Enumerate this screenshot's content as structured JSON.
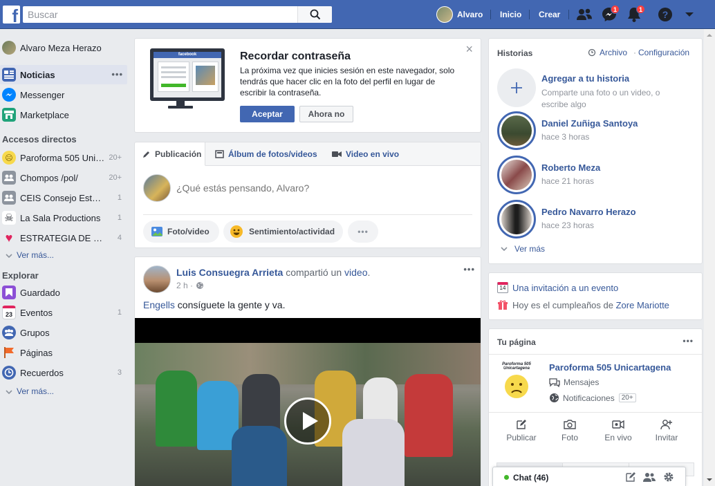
{
  "topbar": {
    "logo": "f",
    "search_placeholder": "Buscar",
    "user": "Alvaro",
    "home": "Inicio",
    "create": "Crear",
    "messenger_badge": "1",
    "notif_badge": "1"
  },
  "left": {
    "profile": "Alvaro Meza Herazo",
    "main": [
      {
        "label": "Noticias"
      },
      {
        "label": "Messenger"
      },
      {
        "label": "Marketplace"
      }
    ],
    "shortcuts_title": "Accesos directos",
    "shortcuts": [
      {
        "label": "Paroforma 505 Unicartagena",
        "count": "20+"
      },
      {
        "label": "Chompos /pol/",
        "count": "20+"
      },
      {
        "label": "CEIS Consejo Estudiantil",
        "count": "1"
      },
      {
        "label": "La Sala Productions",
        "count": "1"
      },
      {
        "label": "ESTRATEGIA DE MERCADEO",
        "count": "4"
      }
    ],
    "see_more": "Ver más...",
    "explore_title": "Explorar",
    "explore": [
      {
        "label": "Guardado",
        "count": ""
      },
      {
        "label": "Eventos",
        "count": "1"
      },
      {
        "label": "Grupos",
        "count": ""
      },
      {
        "label": "Páginas",
        "count": ""
      },
      {
        "label": "Recuerdos",
        "count": "3"
      }
    ],
    "see_more2": "Ver más..."
  },
  "remember": {
    "title": "Recordar contraseña",
    "body": "La próxima vez que inicies sesión en este navegador, solo tendrás que hacer clic en la foto del perfil en lugar de escribir la contraseña.",
    "accept": "Aceptar",
    "decline": "Ahora no",
    "close": "×",
    "mock_brand": "facebook"
  },
  "composer": {
    "tabs": [
      "Publicación",
      "Álbum de fotos/videos",
      "Video en vivo"
    ],
    "placeholder": "¿Qué estás pensando, Alvaro?",
    "actions": [
      "Foto/video",
      "Sentimiento/actividad"
    ],
    "more": "•••"
  },
  "post": {
    "author": "Luis Consuegra Arrieta",
    "shared": "compartió un",
    "video_word": "video",
    "time": "2 h ·",
    "mention": "Engells",
    "text": " consíguete la gente y va.",
    "menu": "•••"
  },
  "stories": {
    "title": "Historias",
    "archive": "Archivo",
    "config": "Configuración",
    "add_title": "Agregar a tu historia",
    "add_sub": "Comparte una foto o un video, o escribe algo",
    "items": [
      {
        "name": "Daniel Zuñiga Santoya",
        "time": "hace 3 horas"
      },
      {
        "name": "Roberto Meza",
        "time": "hace 21 horas"
      },
      {
        "name": "Pedro Navarro Herazo",
        "time": "hace 23 horas"
      }
    ],
    "see_more": "Ver más"
  },
  "events": {
    "invite": "Una invitación a un evento",
    "birthday_prefix": "Hoy es el cumpleaños de ",
    "birthday_name": "Zore Mariotte",
    "calendar_day": "14"
  },
  "page": {
    "title": "Tu página",
    "name": "Paroforma 505 Unicartagena",
    "messages": "Mensajes",
    "notifications": "Notificaciones",
    "notif_count": "20+",
    "actions": [
      "Publicar",
      "Foto",
      "En vivo",
      "Invitar"
    ],
    "logo_text": "Paroforma 505 Unicartagena"
  },
  "chat": {
    "label": "Chat (46)"
  },
  "colors": {
    "brand": "#4267b2",
    "link": "#385898",
    "badge": "#fa3e3e",
    "online": "#42b72a"
  }
}
